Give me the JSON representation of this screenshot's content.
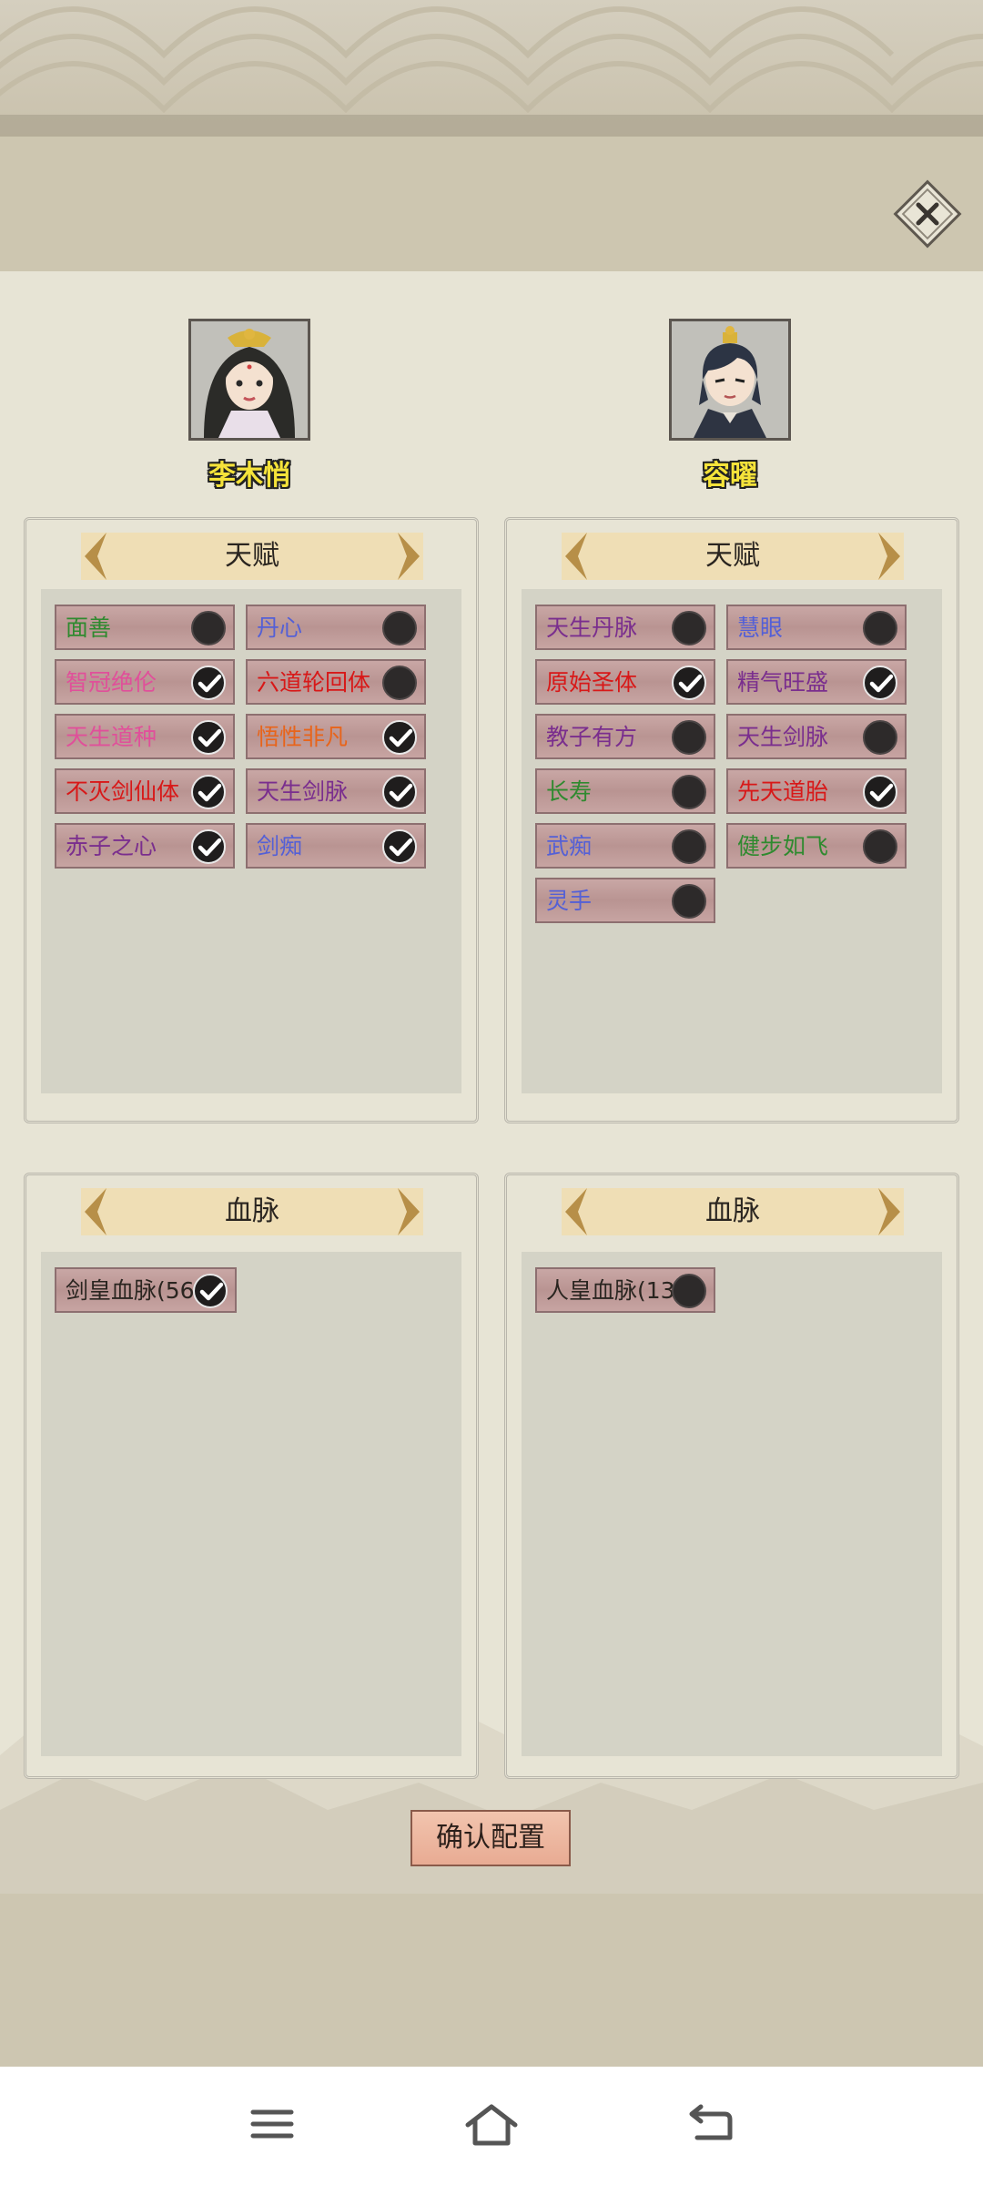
{
  "characters": [
    {
      "name": "李木悄"
    },
    {
      "name": "容曜"
    }
  ],
  "sections": {
    "talent_label": "天赋",
    "bloodline_label": "血脉"
  },
  "left_talents": [
    {
      "label": "面善",
      "color": "#2f8a2f",
      "checked": false
    },
    {
      "label": "丹心",
      "color": "#5460d6",
      "checked": false
    },
    {
      "label": "智冠绝伦",
      "color": "#e0509a",
      "checked": true
    },
    {
      "label": "六道轮回体",
      "color": "#d81818",
      "checked": false
    },
    {
      "label": "天生道种",
      "color": "#e0509a",
      "checked": true
    },
    {
      "label": "悟性非凡",
      "color": "#e8641a",
      "checked": true
    },
    {
      "label": "不灭剑仙体",
      "color": "#d81818",
      "checked": true
    },
    {
      "label": "天生剑脉",
      "color": "#7a2e8e",
      "checked": true
    },
    {
      "label": "赤子之心",
      "color": "#7a2e8e",
      "checked": true
    },
    {
      "label": "剑痴",
      "color": "#5460d6",
      "checked": true
    }
  ],
  "right_talents": [
    {
      "label": "天生丹脉",
      "color": "#7a2e8e",
      "checked": false
    },
    {
      "label": "慧眼",
      "color": "#5460d6",
      "checked": false
    },
    {
      "label": "原始圣体",
      "color": "#d81818",
      "checked": true
    },
    {
      "label": "精气旺盛",
      "color": "#7a2e8e",
      "checked": true
    },
    {
      "label": "教子有方",
      "color": "#7a2e8e",
      "checked": false
    },
    {
      "label": "天生剑脉",
      "color": "#7a2e8e",
      "checked": false
    },
    {
      "label": "长寿",
      "color": "#2f8a2f",
      "checked": false
    },
    {
      "label": "先天道胎",
      "color": "#d81818",
      "checked": true
    },
    {
      "label": "武痴",
      "color": "#5460d6",
      "checked": false
    },
    {
      "label": "健步如飞",
      "color": "#2f8a2f",
      "checked": false
    },
    {
      "label": "灵手",
      "color": "#5460d6",
      "checked": false
    }
  ],
  "left_bloodline": {
    "label": "剑皇血脉(56",
    "color": "#2a2520",
    "checked": true
  },
  "right_bloodline": {
    "label": "人皇血脉(13)",
    "color": "#2a2520",
    "checked": false
  },
  "confirm_label": "确认配置",
  "icons": {
    "close": "close-icon",
    "menu": "menu-icon",
    "home": "home-icon",
    "back": "back-icon",
    "check": "checkmark-icon"
  }
}
